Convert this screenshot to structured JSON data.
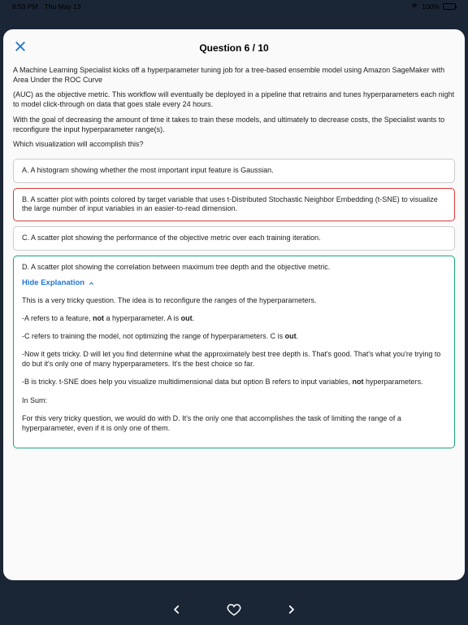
{
  "status": {
    "time": "8:53 PM",
    "date": "Thu May 13",
    "battery_percent": "100%"
  },
  "header": {
    "question_counter": "Question 6 / 10"
  },
  "question": {
    "p1": "A Machine Learning Specialist kicks off a hyperparameter tuning job for a tree-based ensemble model using Amazon SageMaker with Area Under the ROC Curve",
    "p2": "(AUC) as the objective metric. This workflow will eventually be deployed in a pipeline that retrains and tunes hyperparameters each night to model click-through on data that goes stale every 24 hours.",
    "p3": "With the goal of decreasing the amount of time it takes to train these models, and ultimately to decrease costs, the Specialist wants to reconfigure the input hyperparameter range(s).",
    "p4": "Which visualization will accomplish this?"
  },
  "options": {
    "a": "A. A histogram showing whether the most important input feature is Gaussian.",
    "b": "B. A scatter plot with points colored by target variable that uses t-Distributed Stochastic Neighbor Embedding (t-SNE) to visualize the large number of input variables in an easier-to-read dimension.",
    "c": "C. A scatter plot showing the performance of the objective metric over each training iteration.",
    "d": "D. A scatter plot showing the correlation between maximum tree depth and the objective metric."
  },
  "toggle_label": "Hide Explanation",
  "explanation": {
    "e1": "This is a very tricky question. The idea is to reconfigure the ranges of the hyperparameters.",
    "e2_pre": "-A refers to a feature, ",
    "e2_b1": "not",
    "e2_mid": " a hyperparameter. A is ",
    "e2_b2": "out",
    "e2_end": ".",
    "e3_pre": "-C refers to training the model, not optimizing the range of hyperparameters. C is ",
    "e3_b1": "out",
    "e3_end": ".",
    "e4": "-Now it gets tricky. D will let you find determine what the approximately best tree depth is. That's good. That's what you're trying to do but it's only one of many hyperparameters. It's the best choice so far.",
    "e5_pre": "-B is tricky. t-SNE does help you visualize multidimensional data but option B refers to input variables, ",
    "e5_b1": "not",
    "e5_end": " hyperparameters.",
    "e6": "In Sum:",
    "e7": "For this very tricky question, we would do with D. It's the only one that accomplishes the task of limiting the range of a hyperparameter, even if it is only one of them."
  }
}
